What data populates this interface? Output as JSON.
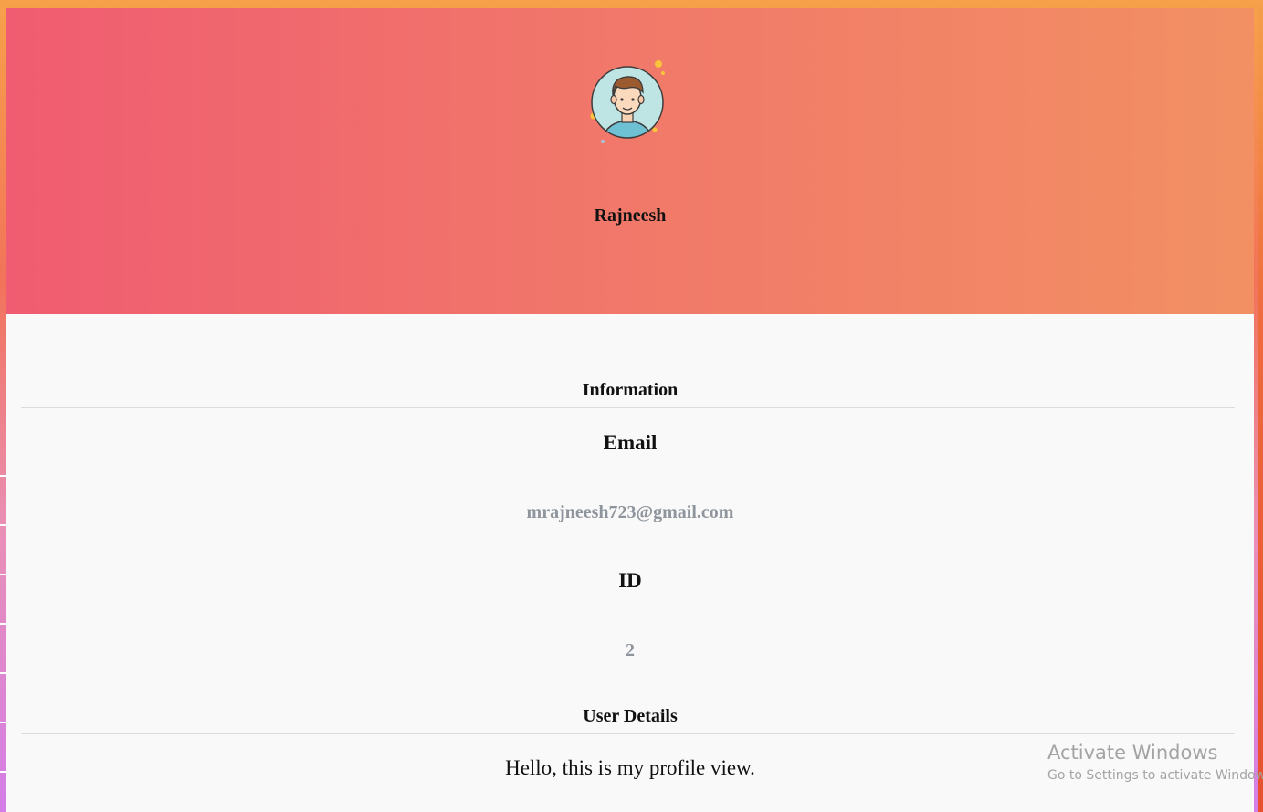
{
  "profile": {
    "name": "Rajneesh"
  },
  "information": {
    "title": "Information",
    "email_label": "Email",
    "email_value": "mrajneesh723@gmail.com",
    "id_label": "ID",
    "id_value": "2"
  },
  "user_details": {
    "title": "User Details",
    "text": "Hello, this is my profile view."
  },
  "watermark": {
    "title": "Activate Windows",
    "subtitle": "Go to Settings to activate Windows."
  },
  "colors": {
    "header_start": "#f05c71",
    "header_end": "#f29063",
    "card_background": "#f9f9f9",
    "value_text": "#8f959c"
  },
  "icons": {
    "avatar": "user-avatar-icon"
  }
}
